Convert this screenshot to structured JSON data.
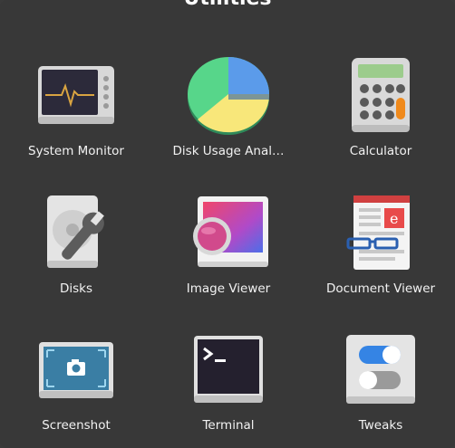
{
  "folder": {
    "title": "Utilities"
  },
  "apps": [
    {
      "label": "System Monitor",
      "icon": "system-monitor-icon"
    },
    {
      "label": "Disk Usage Anal…",
      "icon": "disk-usage-analyzer-icon"
    },
    {
      "label": "Calculator",
      "icon": "calculator-icon"
    },
    {
      "label": "Disks",
      "icon": "disks-icon"
    },
    {
      "label": "Image Viewer",
      "icon": "image-viewer-icon"
    },
    {
      "label": "Document Viewer",
      "icon": "document-viewer-icon"
    },
    {
      "label": "Screenshot",
      "icon": "screenshot-icon"
    },
    {
      "label": "Terminal",
      "icon": "terminal-icon"
    },
    {
      "label": "Tweaks",
      "icon": "tweaks-icon"
    }
  ],
  "colors": {
    "background": "#383838",
    "label_text": "#f2f2f2",
    "toggle_on": "#3584e4"
  }
}
